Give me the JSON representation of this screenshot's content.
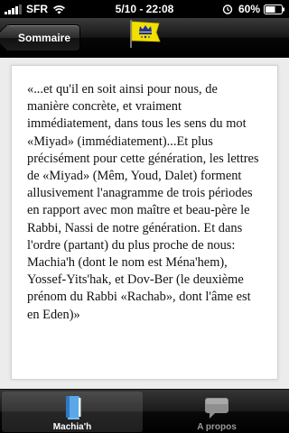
{
  "status_bar": {
    "carrier": "SFR",
    "time": "5/10 - 22:08",
    "battery_percent": "60%"
  },
  "nav_bar": {
    "back_label": "Sommaire",
    "logo_icon": "yellow-flag-crown-icon"
  },
  "content": {
    "text": "«...et qu'il en soit ainsi pour nous, de manière concrète, et vraiment immédiatement, dans tous les sens du mot «Miyad» (immédiatement)...Et plus précisément pour cette génération, les lettres de «Miyad» (Mêm, Youd, Dalet) forment allusivement l'anagramme de trois périodes en rapport avec mon maître et beau-père le Rabbi, Nassi de notre génération. Et dans l'ordre (partant) du plus proche de nous: Machia'h (dont le nom est Ména'hem), Yossef-Yits'hak, et Dov-Ber (le deuxième prénom du Rabbi «Rachab», dont l'âme est en Eden)»"
  },
  "tab_bar": {
    "tabs": [
      {
        "label": "Machia'h",
        "icon": "book-icon",
        "selected": true
      },
      {
        "label": "A propos",
        "icon": "speech-bubble-icon",
        "selected": false
      }
    ]
  },
  "colors": {
    "flag_yellow": "#f2e000",
    "flag_blue": "#1e2fa8",
    "book_blue": "#5aa8e8"
  }
}
